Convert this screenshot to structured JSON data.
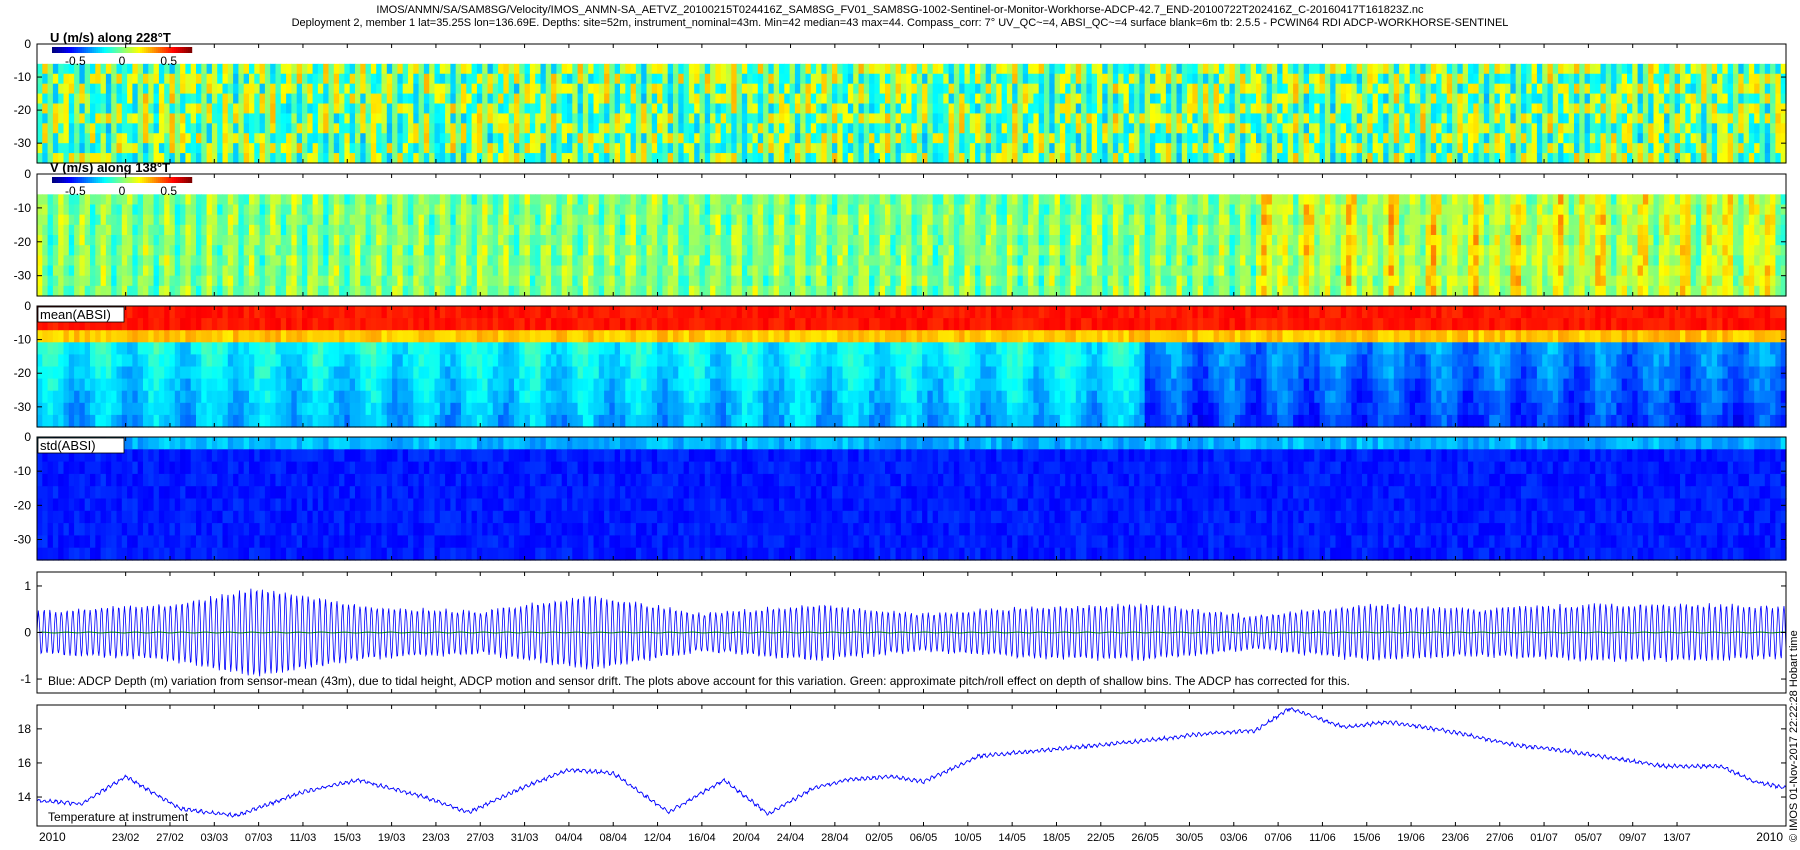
{
  "figure": {
    "title_line1": "IMOS/ANMN/SA/SAM8SG/Velocity/IMOS_ANMN-SA_AETVZ_20100215T024416Z_SAM8SG_FV01_SAM8SG-1002-Sentinel-or-Monitor-Workhorse-ADCP-42.7_END-20100722T202416Z_C-20160417T161823Z.nc",
    "title_line2": "Deployment 2, member 1 lat=35.25S lon=136.69E. Depths: site=52m, instrument_nominal=43m. Min=42 median=43 max=44. Compass_corr: 7° UV_QC~=4, ABSI_QC~=4 surface blank=6m tb: 2.5.5 - PCWIN64 RDI ADCP-WORKHORSE-SENTINEL",
    "credit": "© IMOS 01-Nov-2017 22:22:28 Hobart time",
    "year_label_left": "2010",
    "year_label_right": "2010"
  },
  "chart_data": [
    {
      "type": "heatmap",
      "title": "U (m/s) along 228°T",
      "ylim": [
        -36,
        0
      ],
      "yticks": [
        0,
        -10,
        -20,
        -30
      ],
      "colorbar": {
        "ticks": [
          "-0.5",
          "0",
          "0.5"
        ],
        "range": [
          -0.75,
          0.75
        ]
      },
      "data_depth_range": [
        -36,
        -6
      ],
      "pattern": "mostly near zero (green), scattered bands of positive and negative values"
    },
    {
      "type": "heatmap",
      "title": "V (m/s) along 138°T",
      "ylim": [
        -36,
        0
      ],
      "yticks": [
        0,
        -10,
        -20,
        -30
      ],
      "colorbar": {
        "ticks": [
          "-0.5",
          "0",
          "0.5"
        ],
        "range": [
          -0.75,
          0.75
        ]
      },
      "data_depth_range": [
        -36,
        -6
      ],
      "pattern": "mostly near zero, stronger positive values in June-July"
    },
    {
      "type": "heatmap",
      "title": "mean(ABSI)",
      "ylim": [
        -36,
        0
      ],
      "yticks": [
        0,
        -10,
        -20,
        -30
      ],
      "data_depth_range": [
        -36,
        0
      ],
      "pattern": "high (red/orange) near surface, decreasing with depth; lower overall after late May"
    },
    {
      "type": "heatmap",
      "title": "std(ABSI)",
      "ylim": [
        -36,
        0
      ],
      "yticks": [
        0,
        -10,
        -20,
        -30
      ],
      "data_depth_range": [
        -36,
        0
      ],
      "pattern": "uniformly low (dark blue) with slightly higher values near surface"
    },
    {
      "type": "line",
      "title": "Blue: ADCP Depth (m) variation from sensor-mean (43m), due to tidal height, ADCP motion and sensor drift. The plots above account for this variation. Green: approximate pitch/roll effect on depth of shallow bins. The ADCP has corrected for this.",
      "ylim": [
        -1.3,
        1.3
      ],
      "yticks": [
        1,
        0,
        -1
      ],
      "series": [
        {
          "name": "Blue",
          "color": "#0000ff",
          "amplitude_envelope": [
            [
              0,
              0.45
            ],
            [
              12,
              0.6
            ],
            [
              20,
              0.95
            ],
            [
              30,
              0.55
            ],
            [
              40,
              0.45
            ],
            [
              50,
              0.8
            ],
            [
              60,
              0.4
            ],
            [
              70,
              0.6
            ],
            [
              80,
              0.4
            ],
            [
              90,
              0.55
            ],
            [
              100,
              0.6
            ],
            [
              110,
              0.35
            ],
            [
              120,
              0.6
            ],
            [
              130,
              0.5
            ],
            [
              140,
              0.6
            ],
            [
              150,
              0.6
            ],
            [
              158,
              0.55
            ]
          ]
        },
        {
          "name": "Green",
          "color": "#008000",
          "values": "near zero"
        }
      ]
    },
    {
      "type": "line",
      "title": "Temperature at instrument",
      "ylim": [
        12.3,
        19.4
      ],
      "yticks": [
        14,
        16,
        18
      ],
      "series": [
        {
          "name": "Temperature",
          "color": "#0000ff",
          "x_days_from_start": [
            0,
            4,
            8,
            13,
            18,
            24,
            29,
            35,
            39,
            44,
            48,
            52,
            57,
            62,
            66,
            70,
            73,
            77,
            80,
            85,
            90,
            95,
            100,
            105,
            110,
            113,
            118,
            122,
            128,
            133,
            138,
            142,
            147,
            152,
            155,
            158
          ],
          "values": [
            13.8,
            13.6,
            15.2,
            13.3,
            12.9,
            14.3,
            15.0,
            14.0,
            13.1,
            14.6,
            15.6,
            15.4,
            13.1,
            15.0,
            13.0,
            14.5,
            15.0,
            15.2,
            14.9,
            16.4,
            16.7,
            17.0,
            17.3,
            17.7,
            17.9,
            19.2,
            18.1,
            18.4,
            17.8,
            17.1,
            16.7,
            16.3,
            15.8,
            15.8,
            14.9,
            14.5
          ]
        }
      ]
    }
  ],
  "x_axis": {
    "start": "2010-02-15",
    "end": "2010-07-22",
    "tick_labels": [
      "23/02",
      "27/02",
      "03/03",
      "07/03",
      "11/03",
      "15/03",
      "19/03",
      "23/03",
      "27/03",
      "31/03",
      "04/04",
      "08/04",
      "12/04",
      "16/04",
      "20/04",
      "24/04",
      "28/04",
      "02/05",
      "06/05",
      "10/05",
      "14/05",
      "18/05",
      "22/05",
      "26/05",
      "30/05",
      "03/06",
      "07/06",
      "11/06",
      "15/06",
      "19/06",
      "23/06",
      "27/06",
      "01/07",
      "05/07",
      "09/07",
      "13/07"
    ]
  },
  "colors": {
    "jet_dark_blue": "#00007f",
    "jet_blue": "#0000ff",
    "jet_cyan": "#00ffff",
    "jet_yellow": "#ffff00",
    "jet_red": "#ff0000",
    "jet_dark_red": "#7f0000",
    "line_blue": "#0000ff",
    "line_green": "#008000"
  }
}
